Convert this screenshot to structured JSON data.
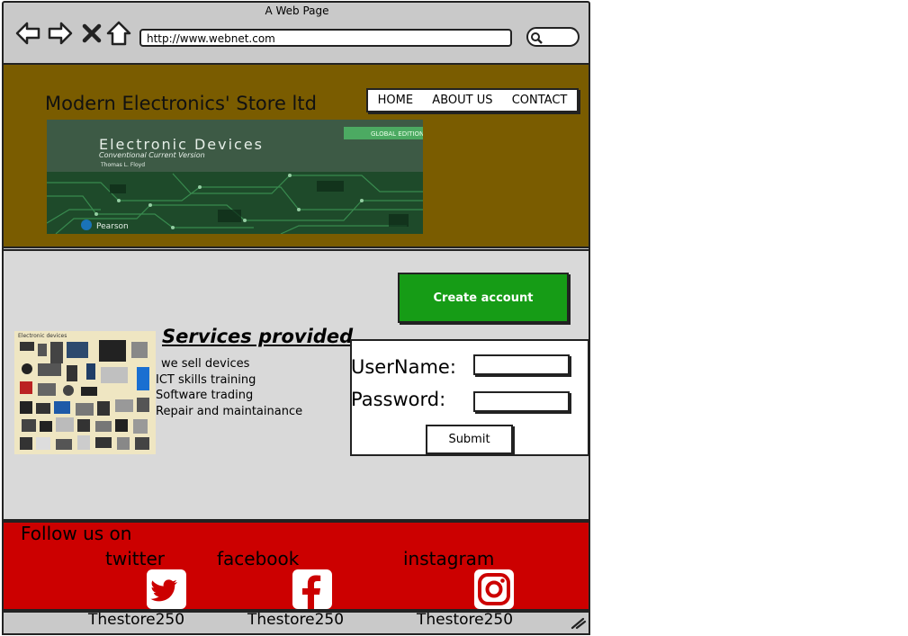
{
  "browser": {
    "window_title": "A Web Page",
    "url": "http://www.webnet.com",
    "icons": [
      "back-arrow-icon",
      "forward-arrow-icon",
      "close-x-icon",
      "home-icon",
      "search-icon"
    ]
  },
  "header": {
    "site_title": "Modern Electronics' Store ltd",
    "nav": {
      "home": "HOME",
      "about": "ABOUT US",
      "contact": "CONTACT"
    },
    "banner": {
      "title": "Electronic Devices",
      "subtitle": "Conventional Current Version",
      "author": "Thomas L. Floyd",
      "edition": "GLOBAL EDITION",
      "publisher": "Pearson"
    }
  },
  "main": {
    "create_account_label": "Create account",
    "services": {
      "image_caption": "Electronic devices",
      "heading": "Services provided",
      "items": [
        "we sell devices",
        "ICT skills training",
        "Software trading",
        "Repair and maintainance"
      ]
    },
    "login": {
      "username_label": "UserName:",
      "password_label": "Password:",
      "username_value": "",
      "password_value": "",
      "submit_label": "Submit"
    }
  },
  "footer": {
    "follow_label": "Follow us on",
    "socials": [
      {
        "name": "twitter",
        "handle": "Thestore250",
        "icon": "twitter-icon"
      },
      {
        "name": "facebook",
        "handle": "Thestore250",
        "icon": "facebook-icon"
      },
      {
        "name": "instagram",
        "handle": "Thestore250",
        "icon": "instagram-icon"
      }
    ]
  },
  "colors": {
    "header_bg": "#7a5c00",
    "main_bg": "#d9d9d9",
    "footer_bg": "#cc0000",
    "create_button_bg": "#169c16",
    "chrome_bg": "#c9c9c9"
  }
}
